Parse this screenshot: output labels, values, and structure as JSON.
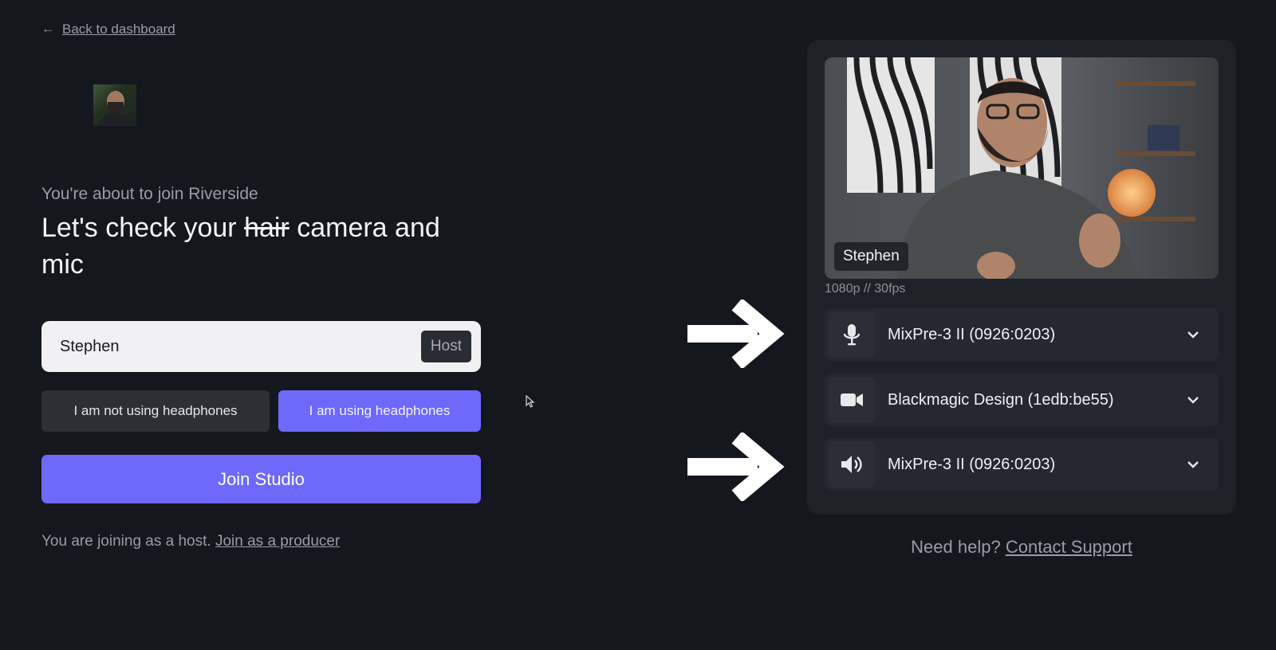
{
  "nav": {
    "back_label": "Back to dashboard"
  },
  "intro": {
    "subtitle": "You're about to join Riverside",
    "headline_before": "Let's check your ",
    "headline_struck": "hair",
    "headline_after": " camera and mic"
  },
  "name_field": {
    "value": "Stephen",
    "role_badge": "Host"
  },
  "headphones": {
    "not_using_label": "I am not using headphones",
    "using_label": "I am using headphones",
    "selected": "using"
  },
  "join": {
    "button_label": "Join Studio",
    "joining_text": "You are joining as a host.",
    "producer_link": "Join as a producer"
  },
  "preview": {
    "participant_name": "Stephen",
    "resolution": "1080p // 30fps"
  },
  "devices": {
    "microphone": {
      "icon": "microphone-icon",
      "label": "MixPre-3 II (0926:0203)"
    },
    "camera": {
      "icon": "video-camera-icon",
      "label": "Blackmagic Design (1edb:be55)"
    },
    "speaker": {
      "icon": "speaker-icon",
      "label": "MixPre-3 II (0926:0203)"
    }
  },
  "help": {
    "prefix": "Need help?",
    "link": "Contact Support"
  },
  "colors": {
    "background": "#15171e",
    "panel": "#1f2129",
    "accent": "#6e68fb",
    "muted_text": "#9a9ca6"
  }
}
